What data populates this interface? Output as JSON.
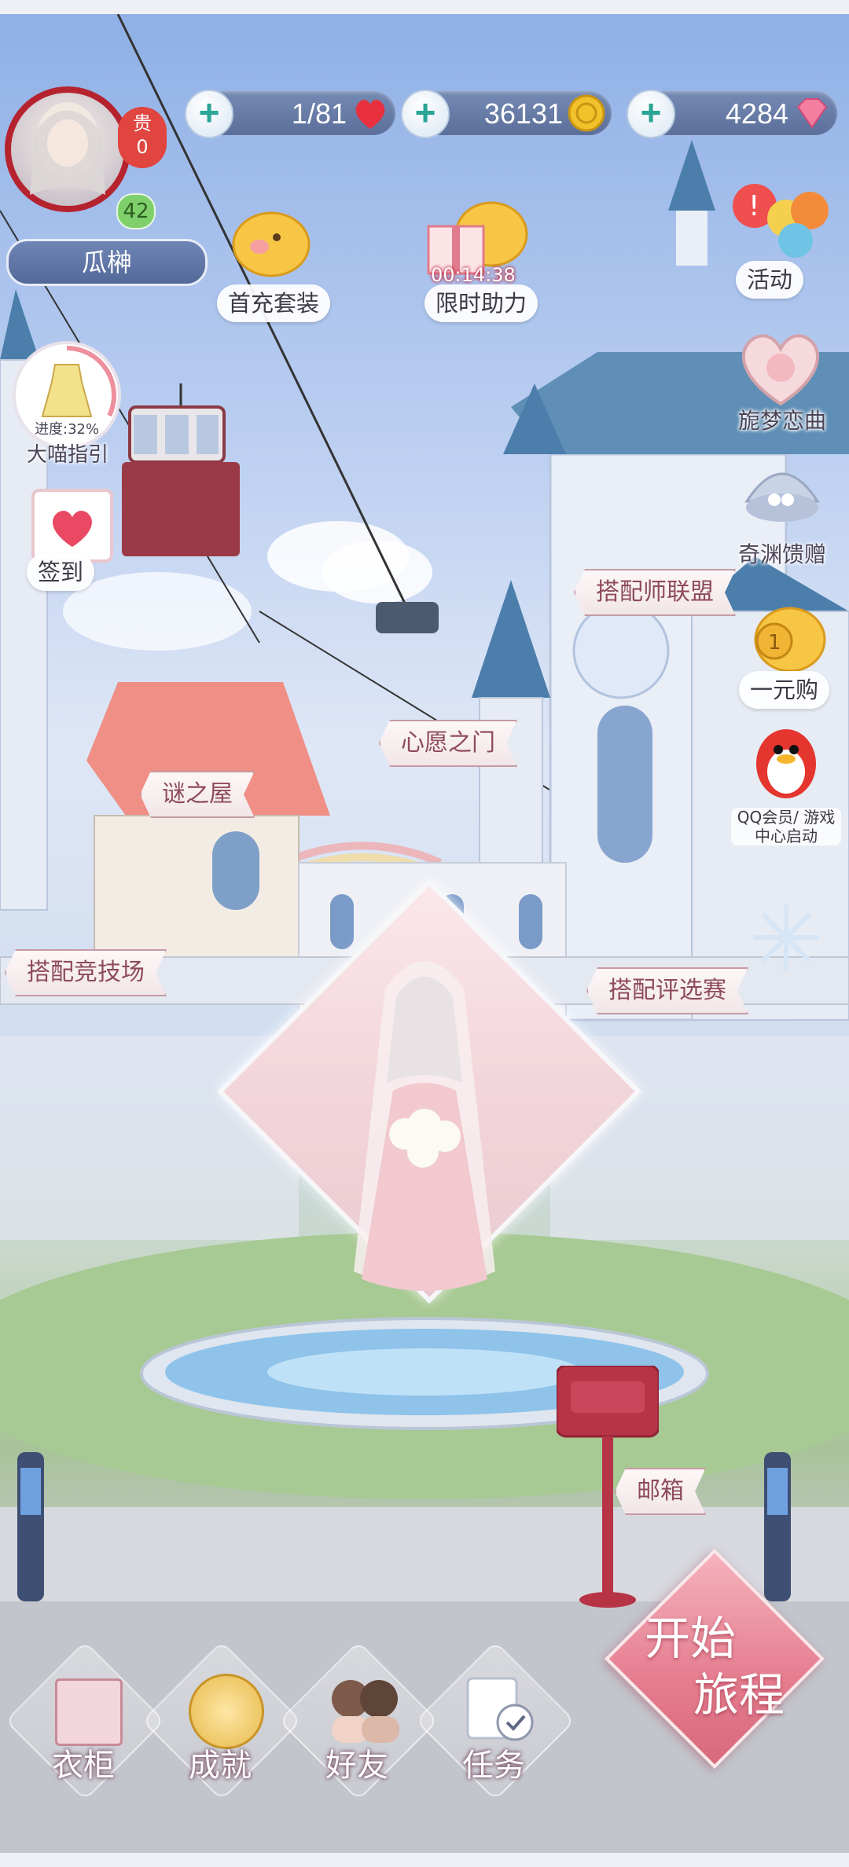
{
  "resources": {
    "stamina": "1/81",
    "coins": "36131",
    "diamonds": "4284"
  },
  "player": {
    "name": "瓜榊",
    "level": "42",
    "vip_label": "贵",
    "vip_value": "0"
  },
  "events_top": [
    {
      "label": "首充套装"
    },
    {
      "label": "限时助力",
      "timer": "00:14:38"
    }
  ],
  "right_menu": {
    "activity": "活动",
    "dream_song": "旎梦恋曲",
    "abyss_gift": "奇渊馈赠",
    "one_yuan": "一元购",
    "qq_vip": "QQ会员/ 游戏中心启动"
  },
  "left_menu": {
    "guide_progress": "进度:32%",
    "guide_label": "大喵指引",
    "checkin": "签到"
  },
  "locations": {
    "stylist_league": "搭配师联盟",
    "wish_gate": "心愿之门",
    "mystery_house": "谜之屋",
    "arena": "搭配竞技场",
    "contest": "搭配评选赛",
    "mailbox": "邮箱"
  },
  "start_journey": {
    "line1": "开始",
    "line2": "旅程"
  },
  "bottom_nav": [
    {
      "label": "衣柜"
    },
    {
      "label": "成就"
    },
    {
      "label": "好友"
    },
    {
      "label": "任务"
    }
  ],
  "colors": {
    "accent_red": "#b5232f",
    "pill_blue": "#5a6f9f",
    "start_pink": "#e57d8f"
  }
}
